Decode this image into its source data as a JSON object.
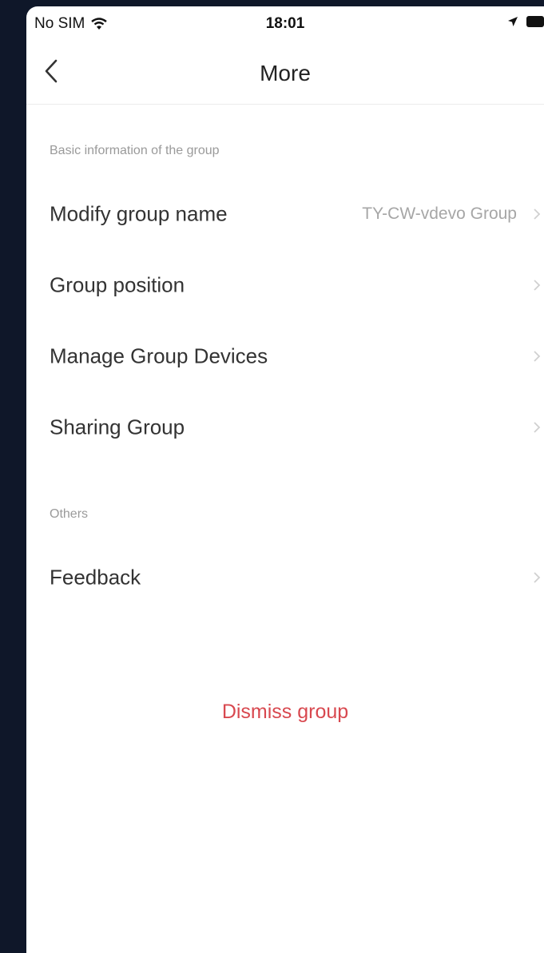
{
  "status_bar": {
    "carrier": "No SIM",
    "time": "18:01"
  },
  "nav": {
    "title": "More"
  },
  "sections": {
    "basic_header": "Basic information of the group",
    "others_header": "Others"
  },
  "rows": {
    "modify_group_name": {
      "label": "Modify group name",
      "value": "TY-CW-vdevo Group"
    },
    "group_position": {
      "label": "Group position"
    },
    "manage_devices": {
      "label": "Manage Group Devices"
    },
    "sharing_group": {
      "label": "Sharing Group"
    },
    "feedback": {
      "label": "Feedback"
    }
  },
  "actions": {
    "dismiss": "Dismiss group"
  },
  "colors": {
    "background_outer": "#0f1729",
    "danger": "#d8484f",
    "secondary_text": "#9a9a9a"
  }
}
